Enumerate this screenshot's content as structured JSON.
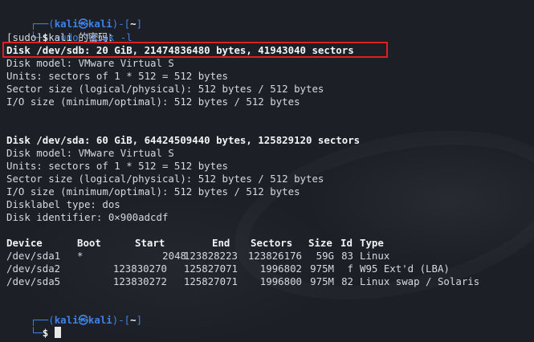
{
  "prompt1": {
    "corner_top": "┌──(",
    "user": "kali",
    "at": "㉿",
    "host": "kali",
    "mid": ")-[",
    "path": "~",
    "end": "]",
    "corner_bottom": "└─",
    "symbol": "$"
  },
  "command": {
    "sudo": "sudo",
    "rest": " fdisk -l"
  },
  "sudo_prompt": "[sudo] kali 的密码：",
  "sdb": {
    "header": "Disk /dev/sdb: 20 GiB, 21474836480 bytes, 41943040 sectors",
    "model": "Disk model: VMware Virtual S",
    "units": "Units: sectors of 1 * 512 = 512 bytes",
    "sector_size": "Sector size (logical/physical): 512 bytes / 512 bytes",
    "io_size": "I/O size (minimum/optimal): 512 bytes / 512 bytes"
  },
  "sda": {
    "header": "Disk /dev/sda: 60 GiB, 64424509440 bytes, 125829120 sectors",
    "model": "Disk model: VMware Virtual S",
    "units": "Units: sectors of 1 * 512 = 512 bytes",
    "sector_size": "Sector size (logical/physical): 512 bytes / 512 bytes",
    "io_size": "I/O size (minimum/optimal): 512 bytes / 512 bytes",
    "label_type": "Disklabel type: dos",
    "identifier": "Disk identifier: 0×900adcdf"
  },
  "partition_table": {
    "headers": [
      "Device",
      "Boot",
      "Start",
      "End",
      "Sectors",
      "Size",
      "Id",
      "Type"
    ],
    "rows": [
      [
        "/dev/sda1",
        "*",
        "2048",
        "123828223",
        "123826176",
        "59G",
        "83",
        "Linux"
      ],
      [
        "/dev/sda2",
        "",
        "123830270",
        "125827071",
        "1996802",
        "975M",
        "f",
        "W95 Ext'd (LBA)"
      ],
      [
        "/dev/sda5",
        "",
        "123830272",
        "125827071",
        "1996800",
        "975M",
        "82",
        "Linux swap / Solaris"
      ]
    ]
  },
  "prompt2": {
    "corner_top": "┌──(",
    "user": "kali",
    "at": "㉿",
    "host": "kali",
    "mid": ")-[",
    "path": "~",
    "end": "]",
    "corner_bottom": "└─",
    "symbol": "$"
  },
  "colors": {
    "background": "#1c1f26",
    "prompt_blue": "#3f82e6",
    "text": "#d7d9dc",
    "highlight_box": "#e02020"
  }
}
